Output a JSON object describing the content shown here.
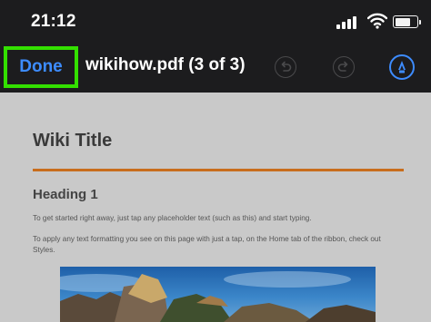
{
  "status_bar": {
    "time": "21:12"
  },
  "nav_bar": {
    "done_label": "Done",
    "document_title": "wikihow.pdf (3 of 3)",
    "icons": [
      "undo-icon",
      "redo-icon",
      "markup-icon"
    ],
    "accent_color": "#3d8cff",
    "highlight_color": "#33e000"
  },
  "document": {
    "title": "Wiki Title",
    "accent_rule_color": "#c86d1c",
    "heading": "Heading 1",
    "paragraph_1": "To get started right away, just tap any placeholder text (such as this) and start typing.",
    "paragraph_2": "To apply any text formatting you see on this page with just a tap, on the Home tab of the ribbon, check out Styles."
  }
}
